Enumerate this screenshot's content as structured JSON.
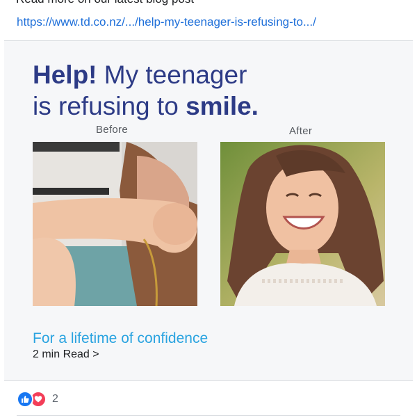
{
  "post": {
    "text": "Read more on our latest blog post",
    "link": "https://www.td.co.nz/.../help-my-teenager-is-refusing-to.../"
  },
  "card": {
    "headline_strong_1": "Help!",
    "headline_rest_1": " My teenager",
    "headline_rest_2": "is refusing to ",
    "headline_strong_2": "smile.",
    "before_label": "Before",
    "after_label": "After",
    "before_image": "teenager-covering-face-photo",
    "after_image": "smiling-teenager-photo",
    "tagline": "For a lifetime of confidence",
    "read_time": "2 min Read >",
    "colors": {
      "headline": "#2d3b86",
      "tagline": "#29a3e0",
      "link": "#1e6fd9"
    }
  },
  "reactions": {
    "icons": [
      "like-icon",
      "love-icon"
    ],
    "count": "2"
  }
}
